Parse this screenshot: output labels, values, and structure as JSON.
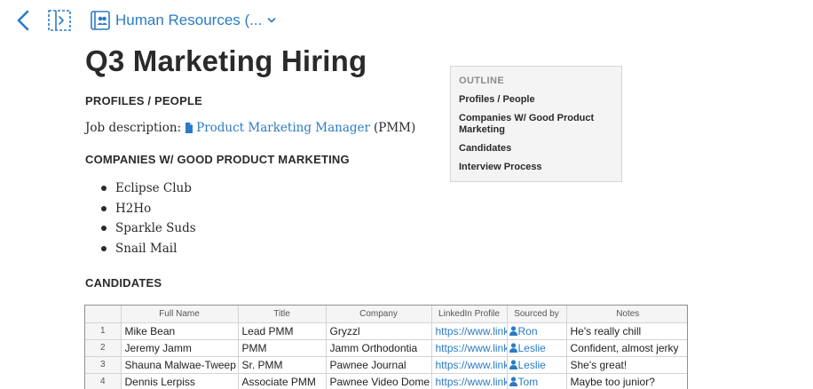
{
  "header": {
    "folder_label": "Human Resources (...",
    "icons": {
      "back": "chevron-left-icon",
      "sidebar": "sidebar-toggle-icon",
      "folder": "shared-folder-icon",
      "dropdown": "chevron-down-icon"
    }
  },
  "document": {
    "title": "Q3 Marketing Hiring",
    "sections": {
      "profiles": "PROFILES / PEOPLE",
      "companies": "COMPANIES W/ GOOD PRODUCT MARKETING",
      "candidates": "CANDIDATES"
    },
    "job_description": {
      "prefix": "Job description:",
      "link_text": "Product Marketing Manager",
      "suffix": "(PMM)"
    },
    "companies": [
      "Eclipse Club",
      "H2Ho",
      "Sparkle Suds",
      "Snail Mail"
    ]
  },
  "outline": {
    "heading": "OUTLINE",
    "items": [
      "Profiles / People",
      "Companies W/ Good Product Marketing",
      "Candidates",
      "Interview Process"
    ]
  },
  "table": {
    "columns": [
      "",
      "Full Name",
      "Title",
      "Company",
      "LinkedIn Profile",
      "Sourced by",
      "Notes"
    ],
    "rows": [
      {
        "num": "1",
        "name": "Mike Bean",
        "title": "Lead PMM",
        "company": "Gryzzl",
        "linkedin": "https://www.linkedin.com",
        "sourced_by": "Ron",
        "notes": "He's really chill"
      },
      {
        "num": "2",
        "name": "Jeremy Jamm",
        "title": "PMM",
        "company": "Jamm Orthodontia",
        "linkedin": "https://www.linkedin.com",
        "sourced_by": "Leslie",
        "notes": "Confident, almost jerky"
      },
      {
        "num": "3",
        "name": "Shauna Malwae-Tweep",
        "title": "Sr. PMM",
        "company": "Pawnee Journal",
        "linkedin": "https://www.linkedin.com",
        "sourced_by": "Leslie",
        "notes": "She's great!"
      },
      {
        "num": "4",
        "name": "Dennis Lerpiss",
        "title": "Associate PMM",
        "company": "Pawnee Video Dome",
        "linkedin": "https://www.linkedin.com",
        "sourced_by": "Tom",
        "notes": "Maybe too junior?"
      }
    ]
  },
  "colors": {
    "accent": "#2b7bc4",
    "text": "#2a2a2a",
    "outline_bg": "#f4f4f4"
  }
}
